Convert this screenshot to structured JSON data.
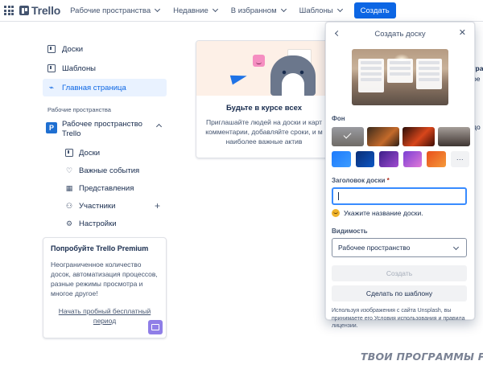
{
  "nav": {
    "logo": "Trello",
    "menu": [
      {
        "label": "Рабочие пространства"
      },
      {
        "label": "Недавние"
      },
      {
        "label": "В избранном"
      },
      {
        "label": "Шаблоны"
      }
    ],
    "create": "Создать"
  },
  "sidebar": {
    "items": [
      {
        "label": "Доски",
        "icon": "board-icon"
      },
      {
        "label": "Шаблоны",
        "icon": "template-icon"
      },
      {
        "label": "Главная страница",
        "icon": "activity-icon"
      }
    ],
    "section_title": "Рабочие пространства",
    "workspace": {
      "badge": "P",
      "name": "Рабочее пространство Trello"
    },
    "sub_items": [
      {
        "label": "Доски",
        "icon": "board-icon"
      },
      {
        "label": "Важные события",
        "icon": "heart-icon"
      },
      {
        "label": "Представления",
        "icon": "grid-icon"
      },
      {
        "label": "Участники",
        "icon": "members-icon"
      },
      {
        "label": "Настройки",
        "icon": "gear-icon"
      }
    ],
    "premium": {
      "title": "Попробуйте Trello Premium",
      "text": "Неограниченное количество досок, автоматизация процессов, разные режимы просмотра и многое другое!",
      "link": "Начать пробный бесплатный период"
    }
  },
  "center": {
    "title": "Будьте в курсе всех",
    "text_lines": [
      "Приглашайте людей на доски и карт",
      "комментарии, добавляйте сроки, и м",
      "наиболее важные актив"
    ]
  },
  "right_fragments": [
    "гра",
    "ре",
    "до"
  ],
  "popover": {
    "title": "Создать доску",
    "background_label": "Фон",
    "photo_colors": [
      "#8c8d93",
      "#b85a2a",
      "#c2410c",
      "#6b6460"
    ],
    "color_swatches": [
      "#2684ff",
      "#0c3b8a",
      "#6e3fc0",
      "#c46ad8",
      "#f06a2b"
    ],
    "more_label": "···",
    "title_label": "Заголовок доски",
    "required_mark": "*",
    "title_value": "",
    "hint": "Укажите название доски.",
    "visibility_label": "Видимость",
    "visibility_value": "Рабочее пространство",
    "create_button": "Создать",
    "template_button": "Сделать по шаблону",
    "footnote": "Используя изображения с сайта Unsplash, вы принимаете его Условия использования и правила лицензии."
  },
  "watermark": "ТВОИ ПРОГРАММЫ РУ"
}
